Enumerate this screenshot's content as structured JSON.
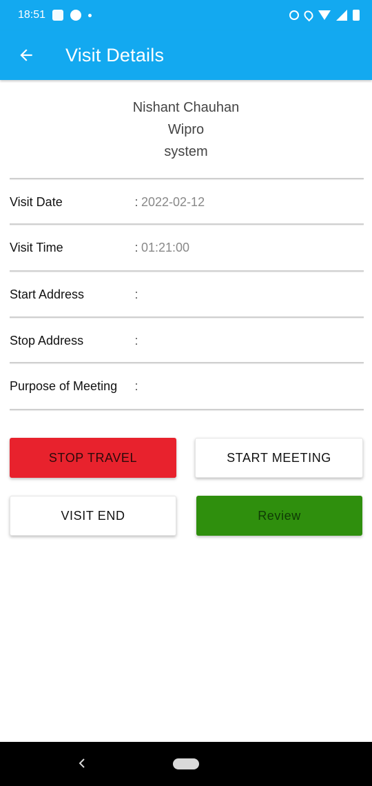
{
  "status_bar": {
    "time": "18:51"
  },
  "app_bar": {
    "title": "Visit Details",
    "back_icon": "arrow-left-icon"
  },
  "visit": {
    "name": "Nishant Chauhan",
    "company": "Wipro",
    "system": "system"
  },
  "details": [
    {
      "label": "Visit Date",
      "colon": ":",
      "value": "2022-02-12"
    },
    {
      "label": "Visit Time",
      "colon": ":",
      "value": "01:21:00"
    },
    {
      "label": "Start Address",
      "colon": ":",
      "value": ""
    },
    {
      "label": "Stop Address",
      "colon": ":",
      "value": ""
    },
    {
      "label": "Purpose of Meeting",
      "colon": ":",
      "value": ""
    }
  ],
  "buttons": {
    "stop_travel": "STOP TRAVEL",
    "start_meeting": "START MEETING",
    "visit_end": "VISIT END",
    "review": "Review"
  },
  "colors": {
    "primary": "#13a9f0",
    "stop_travel": "#e8222d",
    "review": "#2f8f0d"
  }
}
